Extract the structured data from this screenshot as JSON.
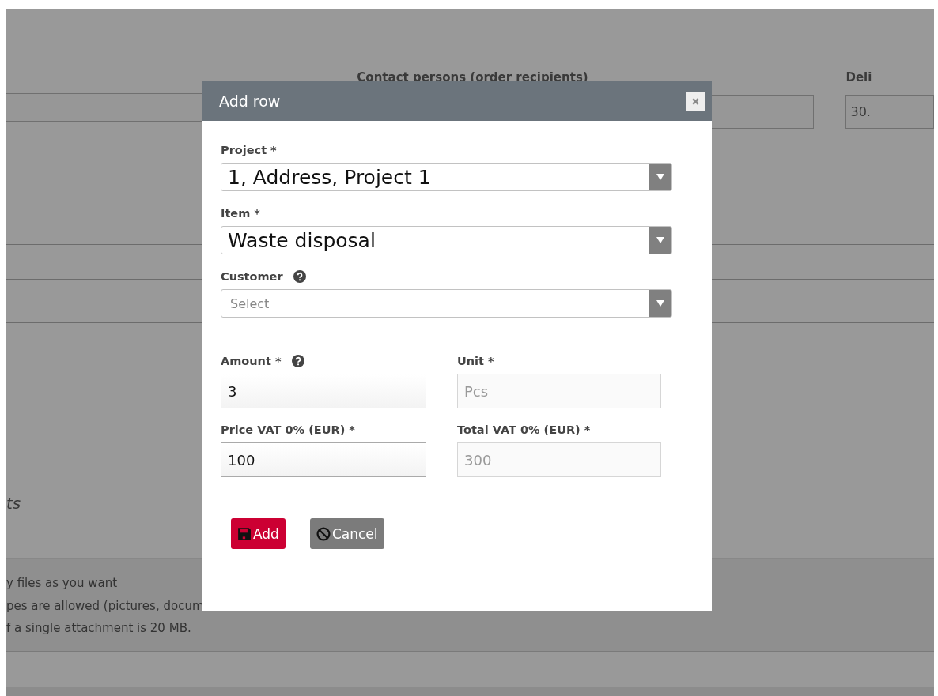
{
  "background": {
    "contact_label": "Contact persons (order recipients)",
    "delivery_label": "Deli",
    "delivery_value": "30.",
    "section_heading": "ts",
    "attachment_notes": [
      "y files as you want",
      "pes are allowed (pictures, docum",
      "f a single attachment is 20 MB."
    ]
  },
  "dialog": {
    "title": "Add row",
    "selects": [
      {
        "label": "Project *",
        "help": false,
        "value": "1, Address, Project 1"
      },
      {
        "label": "Item *",
        "help": false,
        "value": "Waste disposal"
      },
      {
        "label": "Customer",
        "help": true,
        "placeholder": "Select"
      }
    ],
    "inputs": [
      {
        "label": "Amount *",
        "help": true,
        "value": "3",
        "disabled": false
      },
      {
        "label": "Unit *",
        "help": false,
        "value": "Pcs",
        "disabled": true
      },
      {
        "label": "Price VAT 0% (EUR) *",
        "help": false,
        "value": "100",
        "disabled": false
      },
      {
        "label": "Total VAT 0% (EUR) *",
        "help": false,
        "value": "300",
        "disabled": true
      }
    ],
    "buttons": [
      {
        "kind": "save",
        "label": "Add"
      },
      {
        "kind": "cancel",
        "label": "Cancel"
      }
    ]
  }
}
